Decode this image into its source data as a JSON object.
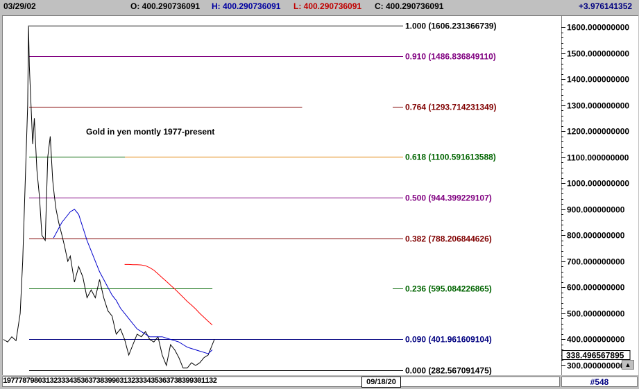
{
  "header": {
    "date": "03/29/02",
    "open": "O: 400.290736091",
    "high": "H: 400.290736091",
    "low": "L: 400.290736091",
    "close": "C: 400.290736091",
    "change": "+3.976141352",
    "colors": {
      "open": "#000000",
      "high": "#0000a0",
      "low": "#c00000",
      "close": "#000000",
      "change": "#000080"
    }
  },
  "footer": {
    "xaxis_labels": "1977787980313233343536373839903132333435363738399301132",
    "cursor_date": "09/18/20",
    "record": "#548"
  },
  "chart_data": {
    "type": "line",
    "title": "Gold in yen montly 1977-present",
    "ylim": [
      280,
      1650
    ],
    "y_ticks": [
      {
        "value": 1600,
        "label": "1600.000000000"
      },
      {
        "value": 1500,
        "label": "1500.000000000"
      },
      {
        "value": 1400,
        "label": "1400.000000000"
      },
      {
        "value": 1300,
        "label": "1300.000000000"
      },
      {
        "value": 1200,
        "label": "1200.000000000"
      },
      {
        "value": 1100,
        "label": "1100.000000000"
      },
      {
        "value": 1000,
        "label": "1000.000000000"
      },
      {
        "value": 900,
        "label": "900.000000000"
      },
      {
        "value": 800,
        "label": "800.000000000"
      },
      {
        "value": 700,
        "label": "700.000000000"
      },
      {
        "value": 600,
        "label": "600.000000000"
      },
      {
        "value": 500,
        "label": "500.000000000"
      },
      {
        "value": 400,
        "label": "400.000000000"
      },
      {
        "value": 300,
        "label": "300.000000000"
      }
    ],
    "last_value_label": "338.496567895",
    "fib_levels": [
      {
        "ratio": "1.000",
        "value": 1606.231366739,
        "label": "1.000 (1606.231366739)",
        "color": "#000000",
        "x_end": 1.0
      },
      {
        "ratio": "0.910",
        "value": 1486.83684911,
        "label": "0.910 (1486.836849110)",
        "color": "#800080",
        "x_end": 1.0
      },
      {
        "ratio": "0.764",
        "value": 1293.714231349,
        "label": "0.764 (1293.714231349)",
        "color": "#800000",
        "x_end": 0.73
      },
      {
        "ratio": "0.618",
        "value": 1100.591613588,
        "label": "0.618 (1100.591613588)",
        "color": "#006400",
        "x_end": 1.0,
        "color2": "#e08000"
      },
      {
        "ratio": "0.500",
        "value": 944.399229107,
        "label": "0.500 (944.399229107)",
        "color": "#800080",
        "x_end": 1.0
      },
      {
        "ratio": "0.382",
        "value": 788.206844626,
        "label": "0.382 (788.206844626)",
        "color": "#800000",
        "x_end": 1.0
      },
      {
        "ratio": "0.236",
        "value": 595.084226865,
        "label": "0.236 (595.084226865)",
        "color": "#006400",
        "x_end": 0.49
      },
      {
        "ratio": "0.090",
        "value": 401.961609104,
        "label": "0.090 (401.961609104)",
        "color": "#000080",
        "x_end": 1.0
      },
      {
        "ratio": "0.000",
        "value": 282.567091475,
        "label": "0.000 (282.567091475)",
        "color": "#000000",
        "x_end": 1.0
      }
    ],
    "series": [
      {
        "name": "",
        "color": "#000000",
        "x": [
          1977,
          1977.5,
          1978,
          1978.5,
          1979,
          1979.3,
          1979.6,
          1979.9,
          1980.0,
          1980.1,
          1980.3,
          1980.5,
          1980.7,
          1981.0,
          1981.3,
          1981.6,
          1982.0,
          1982.3,
          1982.6,
          1982.9,
          1983.1,
          1983.3,
          1983.6,
          1984.0,
          1984.3,
          1984.7,
          1985.0,
          1985.5,
          1986.0,
          1986.5,
          1987.0,
          1987.5,
          1988.0,
          1988.5,
          1989.0,
          1989.5,
          1990.0,
          1990.5,
          1991.0,
          1991.5,
          1992.0,
          1992.5,
          1993.0,
          1993.5,
          1994.0,
          1994.5,
          1995.0,
          1995.5,
          1996.0,
          1996.5,
          1997.0,
          1997.5,
          1998.0,
          1998.5,
          1999.0,
          1999.5,
          2000.0,
          2000.5,
          2001.0,
          2001.5,
          2002.0,
          2002.25
        ],
        "y": [
          400,
          390,
          410,
          395,
          500,
          700,
          1000,
          1300,
          1606,
          1450,
          1300,
          1150,
          1250,
          1050,
          950,
          800,
          780,
          1100,
          1180,
          1010,
          950,
          900,
          850,
          800,
          760,
          700,
          720,
          620,
          680,
          640,
          560,
          590,
          560,
          630,
          560,
          510,
          490,
          420,
          440,
          400,
          340,
          380,
          420,
          410,
          430,
          400,
          390,
          410,
          340,
          300,
          380,
          360,
          330,
          290,
          290,
          310,
          300,
          310,
          330,
          340,
          380,
          400
        ]
      },
      {
        "name": "",
        "color": "#0000cc",
        "x": [
          1983.0,
          1983.5,
          1984.0,
          1984.5,
          1985.0,
          1985.5,
          1986.0,
          1986.5,
          1987.0,
          1987.5,
          1988.0,
          1988.5,
          1989.0,
          1989.5,
          1990.0,
          1990.5,
          1991.0,
          1991.5,
          1992.0,
          1992.5,
          1993.0,
          1993.5,
          1994.0,
          1994.5,
          1995.0,
          1995.5,
          1996.0,
          1996.5,
          1997.0,
          1997.5,
          1998.0,
          1998.5,
          1999.0,
          1999.5,
          2000.0,
          2000.5,
          2001.0,
          2001.5,
          2002.0
        ],
        "y": [
          790,
          820,
          850,
          870,
          890,
          900,
          880,
          830,
          780,
          740,
          700,
          660,
          630,
          600,
          570,
          550,
          520,
          500,
          480,
          460,
          440,
          430,
          420,
          410,
          410,
          410,
          410,
          405,
          400,
          395,
          390,
          380,
          370,
          365,
          360,
          355,
          350,
          345,
          360
        ]
      },
      {
        "name": "",
        "color": "#ff0000",
        "x": [
          1991.5,
          1992.0,
          1992.5,
          1993.0,
          1993.5,
          1994.0,
          1994.5,
          1995.0,
          1995.5,
          1996.0,
          1996.5,
          1997.0,
          1997.5,
          1998.0,
          1998.5,
          1999.0,
          1999.5,
          2000.0,
          2000.5,
          2001.0,
          2001.5,
          2002.0
        ],
        "y": [
          688,
          688,
          687,
          687,
          686,
          683,
          676,
          666,
          652,
          637,
          623,
          608,
          594,
          578,
          562,
          546,
          532,
          517,
          500,
          485,
          470,
          455
        ]
      }
    ],
    "xlim": [
      1977,
      2010
    ],
    "grid": false
  }
}
